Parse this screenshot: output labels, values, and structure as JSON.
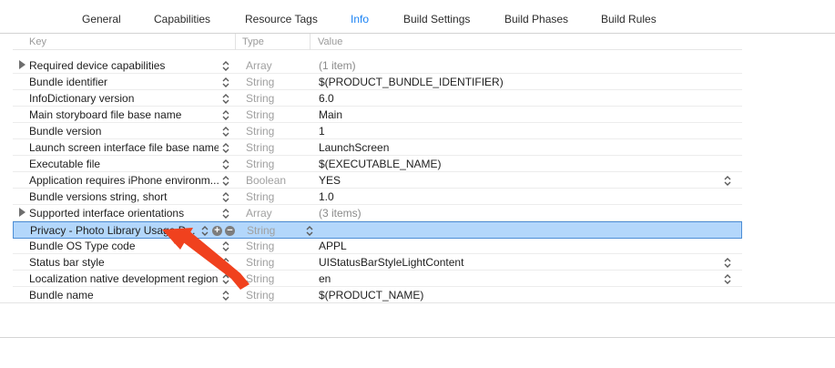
{
  "tabs": [
    {
      "label": "General",
      "active": false
    },
    {
      "label": "Capabilities",
      "active": false
    },
    {
      "label": "Resource Tags",
      "active": false
    },
    {
      "label": "Info",
      "active": true
    },
    {
      "label": "Build Settings",
      "active": false
    },
    {
      "label": "Build Phases",
      "active": false
    },
    {
      "label": "Build Rules",
      "active": false
    }
  ],
  "columns": {
    "key": "Key",
    "type": "Type",
    "value": "Value"
  },
  "rows": [
    {
      "key": "Required device capabilities",
      "type": "Array",
      "value": "(1 item)",
      "expandable": true
    },
    {
      "key": "Bundle identifier",
      "type": "String",
      "value": "$(PRODUCT_BUNDLE_IDENTIFIER)"
    },
    {
      "key": "InfoDictionary version",
      "type": "String",
      "value": "6.0"
    },
    {
      "key": "Main storyboard file base name",
      "type": "String",
      "value": "Main"
    },
    {
      "key": "Bundle version",
      "type": "String",
      "value": "1"
    },
    {
      "key": "Launch screen interface file base name",
      "type": "String",
      "value": "LaunchScreen"
    },
    {
      "key": "Executable file",
      "type": "String",
      "value": "$(EXECUTABLE_NAME)"
    },
    {
      "key": "Application requires iPhone environm...",
      "type": "Boolean",
      "value": "YES",
      "value_stepper": true
    },
    {
      "key": "Bundle versions string, short",
      "type": "String",
      "value": "1.0"
    },
    {
      "key": "Supported interface orientations",
      "type": "Array",
      "value": "(3 items)",
      "expandable": true
    },
    {
      "key": "Privacy - Photo Library Usage D...",
      "type": "String",
      "value": "",
      "selected": true
    },
    {
      "key": "Bundle OS Type code",
      "type": "String",
      "value": "APPL"
    },
    {
      "key": "Status bar style",
      "type": "String",
      "value": "UIStatusBarStyleLightContent",
      "value_stepper": true
    },
    {
      "key": "Localization native development region",
      "type": "String",
      "value": "en",
      "value_stepper": true
    },
    {
      "key": "Bundle name",
      "type": "String",
      "value": "$(PRODUCT_NAME)"
    }
  ],
  "colors": {
    "accent": "#1a82f4",
    "selection": "#b3d7fb",
    "annotation_arrow": "#f0411e"
  },
  "icons": {
    "expand": "disclosure-triangle-icon",
    "stepper": "up-down-stepper-icon",
    "add": "plus-circle-icon",
    "remove": "minus-circle-icon"
  }
}
